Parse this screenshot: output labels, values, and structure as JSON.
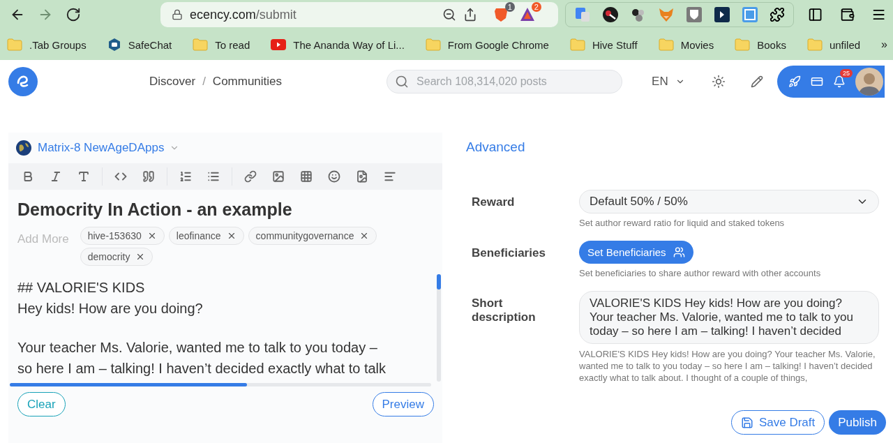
{
  "browser": {
    "url_host": "ecency.com",
    "url_path": "/submit",
    "shield_badge": "1",
    "rewards_badge": "2",
    "forward_disabled": true
  },
  "bookmarks": [
    {
      "kind": "folder",
      "label": ".Tab Groups"
    },
    {
      "kind": "app",
      "label": "SafeChat"
    },
    {
      "kind": "folder",
      "label": "To read"
    },
    {
      "kind": "video",
      "label": "The Ananda Way of Li..."
    },
    {
      "kind": "folder",
      "label": "From Google Chrome"
    },
    {
      "kind": "folder",
      "label": "Hive Stuff"
    },
    {
      "kind": "folder",
      "label": "Movies"
    },
    {
      "kind": "folder",
      "label": "Books"
    },
    {
      "kind": "folder",
      "label": "unfiled"
    }
  ],
  "bookmarks_more": "»",
  "header": {
    "breadcrumb": [
      "Discover",
      "Communities"
    ],
    "separator": "/",
    "search_placeholder": "Search 108,314,020 posts",
    "language": "EN",
    "notifications": "25"
  },
  "editor": {
    "community": "Matrix-8 NewAgeDApps",
    "title": "Democrity In Action - an example",
    "tags_placeholder": "Add More",
    "tags": [
      "hive-153630",
      "leofinance",
      "communitygovernance",
      "democrity"
    ],
    "body": [
      [
        "## VALORIE'S KIDS",
        "Hey kids! How are you doing?"
      ],
      [
        "Your teacher Ms. Valorie, wanted me to talk to you today –",
        "so here I am – talking! I haven’t decided exactly what to talk"
      ]
    ],
    "buttons": [
      "Clear",
      "Preview"
    ]
  },
  "advanced": {
    "title": "Advanced",
    "reward": {
      "label": "Reward",
      "value": "Default 50% / 50%",
      "hint": "Set author reward ratio for liquid and staked tokens"
    },
    "beneficiaries": {
      "label": "Beneficiaries",
      "button": "Set Beneficiaries",
      "hint": "Set beneficiaries to share author reward with other accounts"
    },
    "description": {
      "label": "Short description",
      "value": "VALORIE'S KIDS Hey kids! How are you doing? Your teacher Ms. Valorie, wanted me to talk to you today – so here I am – talking! I haven’t decided",
      "preview": "VALORIE'S KIDS Hey kids! How are you doing? Your teacher Ms. Valorie, wanted me to talk to you today – so here I am – talking! I haven’t decided exactly what to talk about. I thought of a couple of things,"
    },
    "buttons": [
      "Save Draft",
      "Publish"
    ]
  }
}
